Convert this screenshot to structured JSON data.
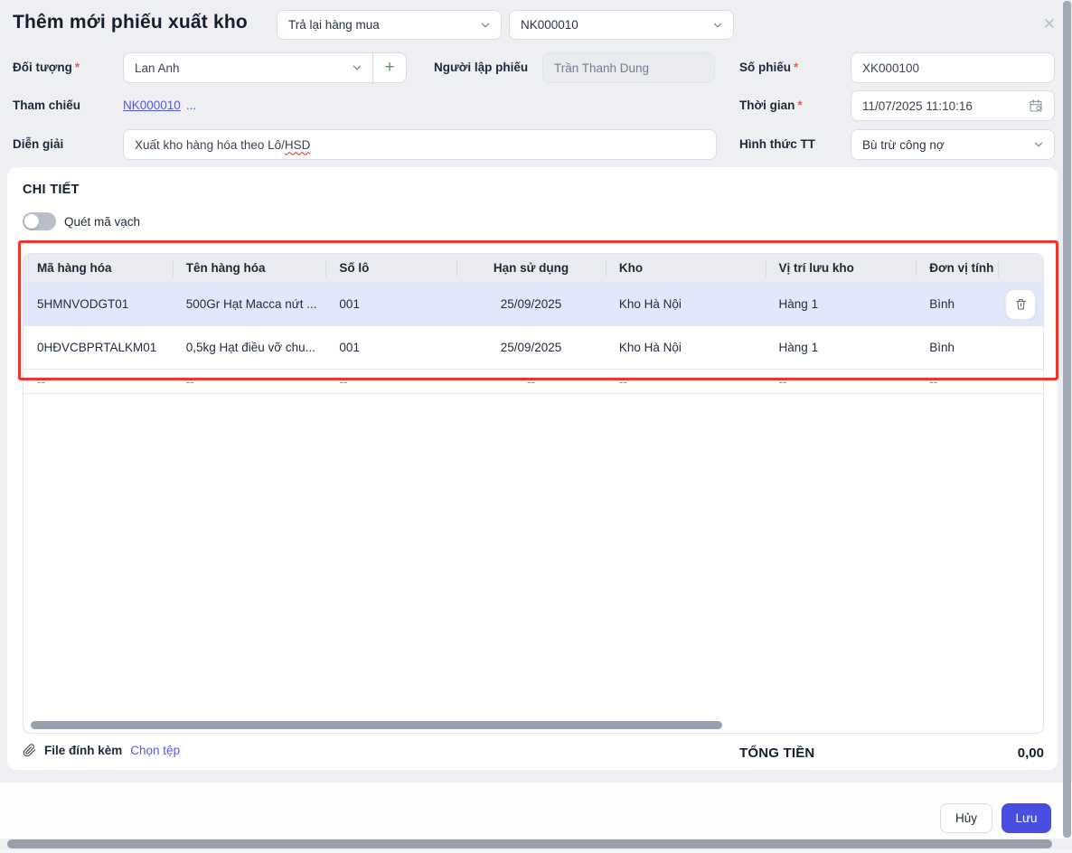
{
  "header": {
    "title": "Thêm mới phiếu xuất kho",
    "type_select": "Trả lại hàng mua",
    "ref_select": "NK000010",
    "close_icon": "✕"
  },
  "form": {
    "doi_tuong": {
      "label": "Đối tượng",
      "required": "*",
      "value": "Lan Anh",
      "add_label": "+"
    },
    "nguoi_lap": {
      "label": "Người lập phiếu",
      "value": "Trần Thanh Dung"
    },
    "so_phieu": {
      "label": "Số phiếu",
      "required": "*",
      "value": "XK000100"
    },
    "tham_chieu": {
      "label": "Tham chiếu",
      "link": "NK000010",
      "more": "..."
    },
    "thoi_gian": {
      "label": "Thời gian",
      "required": "*",
      "value": "11/07/2025 11:10:16"
    },
    "dien_giai": {
      "label": "Diễn giải",
      "value_main": "Xuất kho hàng hóa theo Lô/",
      "value_misspelled": "HSD"
    },
    "hinh_thuc": {
      "label": "Hình thức TT",
      "value": "Bù trừ công nợ"
    }
  },
  "detail": {
    "title": "CHI TIẾT",
    "barcode_toggle_label": "Quét mã vạch",
    "table": {
      "columns": [
        "Mã hàng hóa",
        "Tên hàng hóa",
        "Số lô",
        "Hạn sử dụng",
        "Kho",
        "Vị trí lưu kho",
        "Đơn vị tính"
      ],
      "rows": [
        {
          "code": "5HMNVODGT01",
          "name": "500Gr Hạt Macca nứt ...",
          "lot": "001",
          "expiry": "25/09/2025",
          "warehouse": "Kho Hà Nội",
          "location": "Hàng 1",
          "unit": "Bình"
        },
        {
          "code": "0HĐVCBPRTALKM01",
          "name": "0,5kg Hạt điều vỡ chu...",
          "lot": "001",
          "expiry": "25/09/2025",
          "warehouse": "Kho Hà Nội",
          "location": "Hàng 1",
          "unit": "Bình"
        }
      ],
      "empty_placeholder": "--"
    },
    "attachment": {
      "label": "File đính kèm",
      "choose_label": "Chọn tệp"
    },
    "total": {
      "label": "TỔNG TIỀN",
      "value": "0,00"
    }
  },
  "footer": {
    "cancel": "Hủy",
    "save": "Lưu"
  },
  "colors": {
    "accent": "#4a4ee0",
    "link": "#5559e2",
    "row_highlight": "#e2e8f9",
    "annotation": "#ea372a"
  }
}
